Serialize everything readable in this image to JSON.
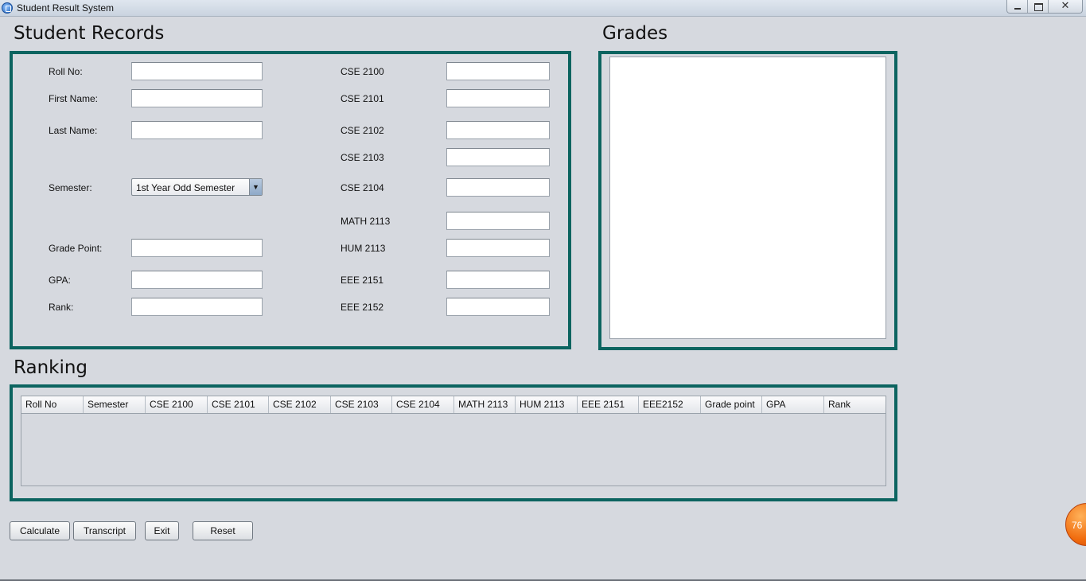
{
  "window": {
    "title": "Student Result System"
  },
  "sections": {
    "student_records": "Student Records",
    "grades": "Grades",
    "ranking": "Ranking"
  },
  "form": {
    "roll_no_label": "Roll No:",
    "first_name_label": "First Name:",
    "last_name_label": "Last Name:",
    "semester_label": "Semester:",
    "semester_value": "1st Year Odd Semester",
    "grade_point_label": "Grade Point:",
    "gpa_label": "GPA:",
    "rank_label": "Rank:"
  },
  "courses": [
    "CSE 2100",
    "CSE 2101",
    "CSE 2102",
    "CSE 2103",
    "CSE 2104",
    "MATH 2113",
    "HUM 2113",
    "EEE 2151",
    "EEE 2152"
  ],
  "table": {
    "columns": [
      "Roll No",
      "Semester",
      "CSE 2100",
      "CSE 2101",
      "CSE 2102",
      "CSE 2103",
      "CSE 2104",
      "MATH 2113",
      "HUM 2113",
      "EEE 2151",
      "EEE2152",
      "Grade point",
      "GPA",
      "Rank"
    ]
  },
  "buttons": {
    "calculate": "Calculate",
    "transcript": "Transcript",
    "exit": "Exit",
    "reset": "Reset"
  },
  "badge": {
    "value": "76"
  }
}
